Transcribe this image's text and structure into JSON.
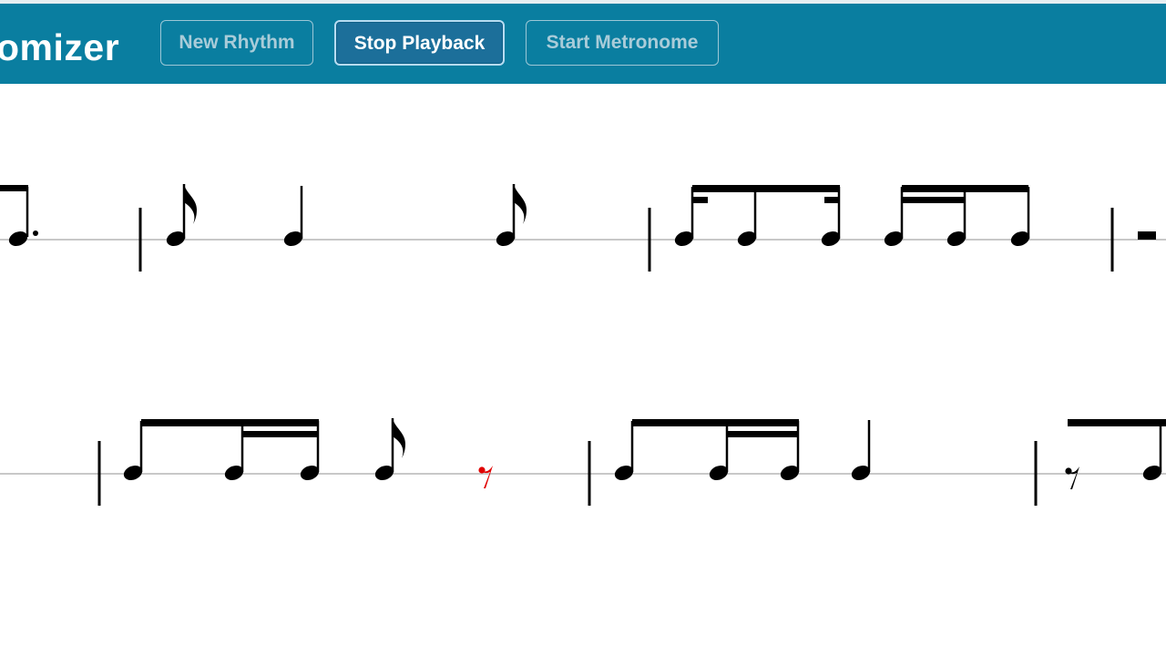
{
  "header": {
    "app_title": "omizer",
    "buttons": [
      {
        "label": "New Rhythm",
        "state": "disabled"
      },
      {
        "label": "Stop Playback",
        "state": "active"
      },
      {
        "label": "Start Metronome",
        "state": "disabled"
      }
    ]
  },
  "colors": {
    "header_bg": "#0a7ea0",
    "active_button_bg": "#1c6f9a",
    "note_color": "#000000",
    "highlight_color": "#e00000",
    "staff_line_color": "#c8c8c8"
  },
  "score": {
    "rows": [
      {
        "measures": [
          {
            "items": [
              "dotted-note (cut off)"
            ]
          },
          {
            "items": [
              "eighth-note",
              "quarter-note",
              "eighth-note"
            ]
          },
          {
            "items": [
              "dotted-eighth-sixteenth-beam",
              "eighth-note",
              "sixteenth-sixteenth-eighth-beam"
            ]
          },
          {
            "items": [
              "whole-rest (cut off)"
            ]
          }
        ]
      },
      {
        "measures": [
          {
            "items": [
              "eighth-sixteenth-sixteenth-beam",
              "eighth-note",
              "eighth-rest (current)"
            ]
          },
          {
            "items": [
              "eighth-sixteenth-sixteenth-beam",
              "quarter-note"
            ]
          },
          {
            "items": [
              "eighth-rest",
              "eighth-note (cut off)"
            ]
          }
        ]
      }
    ],
    "current_position": {
      "row": 2,
      "measure": 1,
      "item": 3
    }
  }
}
